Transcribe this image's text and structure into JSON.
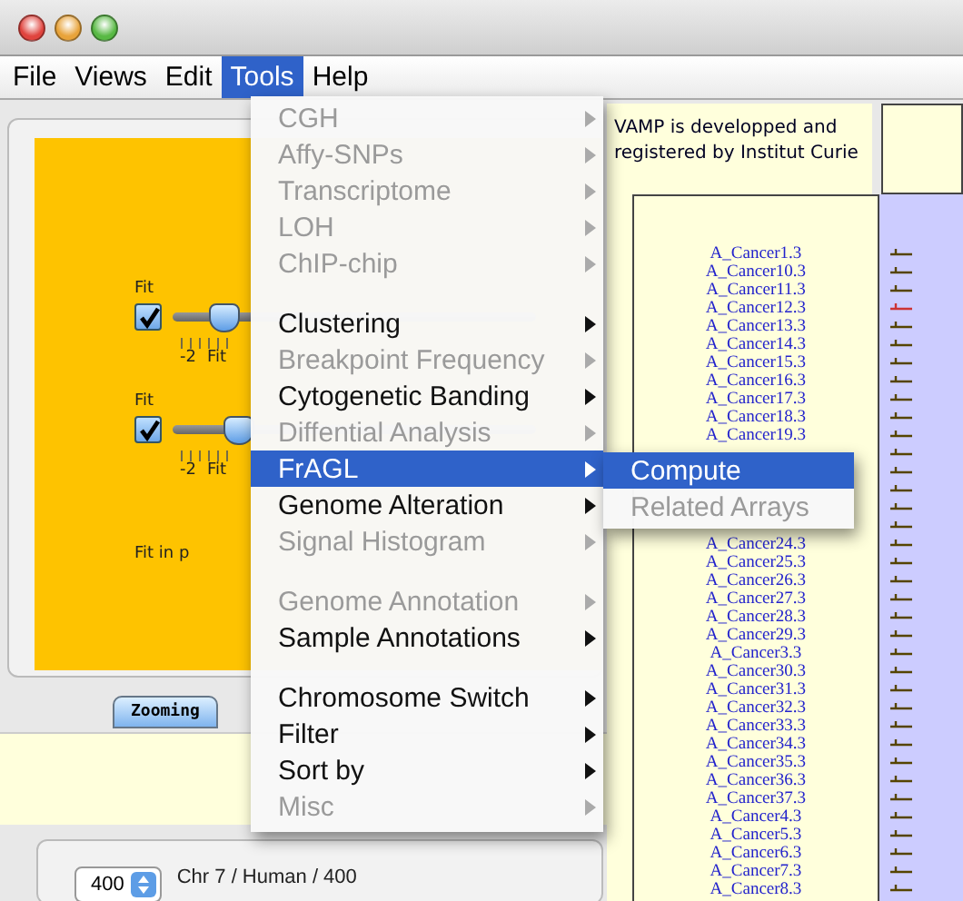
{
  "menubar": [
    {
      "label": "File",
      "selected": false
    },
    {
      "label": "Views",
      "selected": false
    },
    {
      "label": "Edit",
      "selected": false
    },
    {
      "label": "Tools",
      "selected": true
    },
    {
      "label": "Help",
      "selected": false
    }
  ],
  "tools_menu": [
    {
      "kind": "item",
      "label": "CGH",
      "disabled": true,
      "selected": false
    },
    {
      "kind": "item",
      "label": "Affy-SNPs",
      "disabled": true,
      "selected": false
    },
    {
      "kind": "item",
      "label": "Transcriptome",
      "disabled": true,
      "selected": false
    },
    {
      "kind": "item",
      "label": "LOH",
      "disabled": true,
      "selected": false
    },
    {
      "kind": "item",
      "label": "ChIP-chip",
      "disabled": true,
      "selected": false
    },
    {
      "kind": "separator"
    },
    {
      "kind": "item",
      "label": "Clustering",
      "disabled": false,
      "selected": false
    },
    {
      "kind": "item",
      "label": "Breakpoint Frequency",
      "disabled": true,
      "selected": false
    },
    {
      "kind": "item",
      "label": "Cytogenetic Banding",
      "disabled": false,
      "selected": false
    },
    {
      "kind": "item",
      "label": "Diffential Analysis",
      "disabled": true,
      "selected": false
    },
    {
      "kind": "item",
      "label": "FrAGL",
      "disabled": false,
      "selected": true
    },
    {
      "kind": "item",
      "label": "Genome Alteration",
      "disabled": false,
      "selected": false
    },
    {
      "kind": "item",
      "label": "Signal Histogram",
      "disabled": true,
      "selected": false
    },
    {
      "kind": "separator"
    },
    {
      "kind": "item",
      "label": "Genome Annotation",
      "disabled": true,
      "selected": false
    },
    {
      "kind": "item",
      "label": "Sample Annotations",
      "disabled": false,
      "selected": false
    },
    {
      "kind": "separator"
    },
    {
      "kind": "item",
      "label": "Chromosome Switch",
      "disabled": false,
      "selected": false
    },
    {
      "kind": "item",
      "label": "Filter",
      "disabled": false,
      "selected": false
    },
    {
      "kind": "item",
      "label": "Sort by",
      "disabled": false,
      "selected": false
    },
    {
      "kind": "item",
      "label": "Misc",
      "disabled": true,
      "selected": false
    }
  ],
  "fragl_submenu": [
    {
      "label": "Compute",
      "disabled": false,
      "selected": true
    },
    {
      "label": "Related Arrays",
      "disabled": true,
      "selected": false
    }
  ],
  "zoom_controls": [
    {
      "label": "Fit",
      "checked": true,
      "level": 0.1,
      "tick_labels": [
        "-2",
        "Fit"
      ]
    },
    {
      "label": "Fit",
      "checked": true,
      "level": 0.14,
      "tick_labels": [
        "-2",
        "Fit"
      ]
    }
  ],
  "fit_text": "Fit in p",
  "tabs": [
    {
      "label": "Zooming",
      "selected": true
    }
  ],
  "stepper": {
    "value": "400"
  },
  "sample_info": "Chr 7 / Human / 400",
  "credit": "VAMP is developped and registered by Institut Curie",
  "names_top": [
    "A_Cancer1.3",
    "A_Cancer10.3",
    "A_Cancer11.3",
    "A_Cancer12.3",
    "A_Cancer13.3",
    "A_Cancer14.3",
    "A_Cancer15.3",
    "A_Cancer16.3",
    "A_Cancer17.3",
    "A_Cancer18.3",
    "A_Cancer19.3"
  ],
  "names_bottom": [
    "A_Cancer24.3",
    "A_Cancer25.3",
    "A_Cancer26.3",
    "A_Cancer27.3",
    "A_Cancer28.3",
    "A_Cancer29.3",
    "A_Cancer3.3",
    "A_Cancer30.3",
    "A_Cancer31.3",
    "A_Cancer32.3",
    "A_Cancer33.3",
    "A_Cancer34.3",
    "A_Cancer35.3",
    "A_Cancer36.3",
    "A_Cancer37.3",
    "A_Cancer4.3",
    "A_Cancer5.3",
    "A_Cancer6.3",
    "A_Cancer7.3",
    "A_Cancer8.3"
  ]
}
